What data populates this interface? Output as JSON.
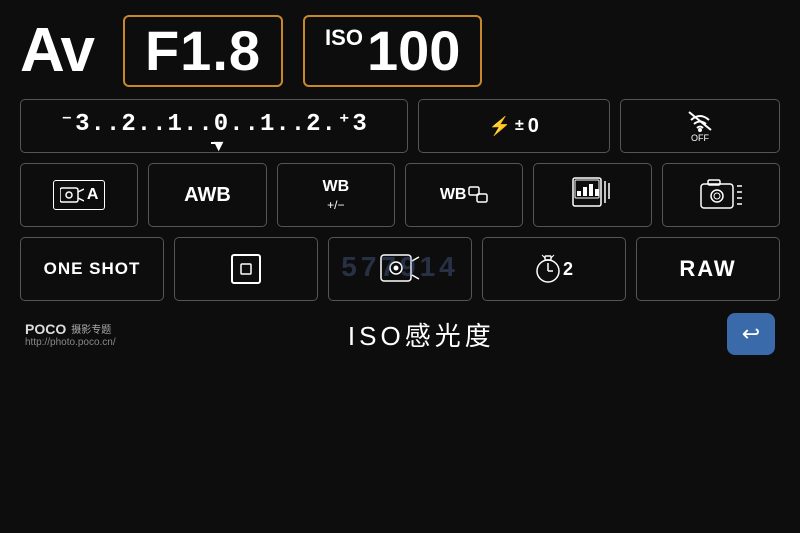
{
  "mode": {
    "label": "Av"
  },
  "aperture": {
    "label": "F1.8"
  },
  "iso": {
    "prefix": "ISO",
    "value": "100"
  },
  "exposure": {
    "scale": "⁻3..2..1..0..1..2.⁺3",
    "marker": "▲"
  },
  "flash_comp": {
    "icon": "⚡±",
    "value": "±0"
  },
  "wifi": {
    "label": "OFF"
  },
  "settings": {
    "metering": "⊠A",
    "wb": "AWB",
    "wb_adj": "WB\n+/−",
    "wb_shift": "WB⇌",
    "picture_style": "📊",
    "creative_auto": "📷≡"
  },
  "bottom_settings": {
    "af_mode": "ONE SHOT",
    "af_point": "□",
    "live_view": "◎",
    "drive": "⏱2",
    "quality": "RAW"
  },
  "footer": {
    "brand": "POCO",
    "brand_sub": "摄影专题",
    "url": "http://photo.poco.cn/",
    "iso_label": "ISO感光度",
    "back": "↩"
  },
  "watermark": {
    "text": "577914"
  },
  "colors": {
    "border_active": "#c8882a",
    "border_normal": "#555555",
    "bg": "#0d0d0d",
    "back_btn": "#3a6aaa"
  }
}
